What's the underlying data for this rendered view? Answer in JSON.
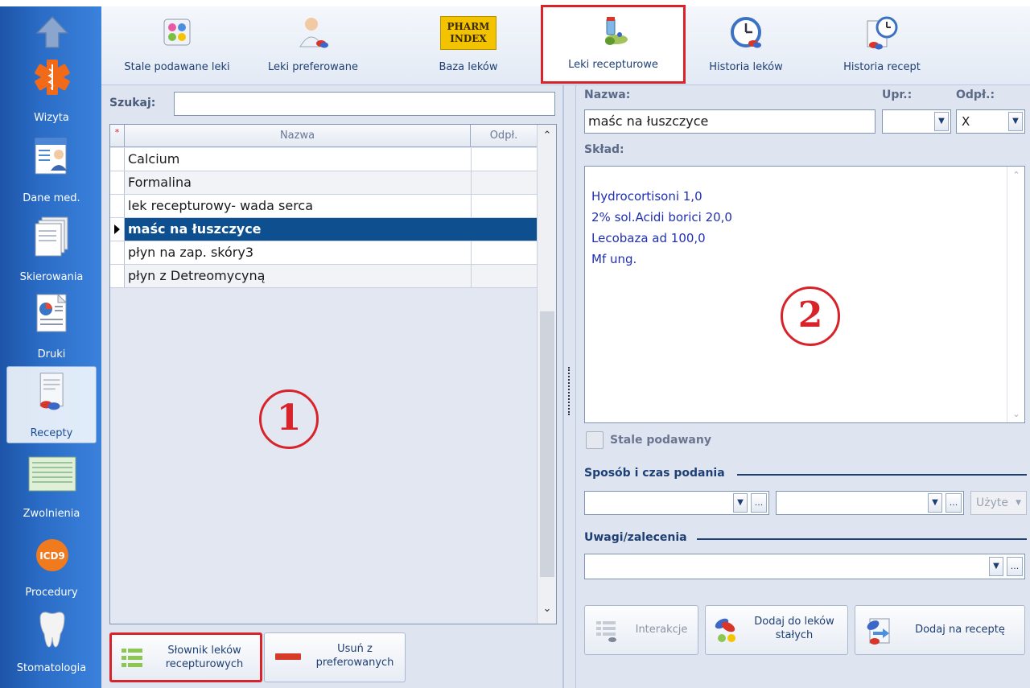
{
  "nav": {
    "items": [
      {
        "label": "",
        "icon": "up-arrow-icon"
      },
      {
        "label": "Wizyta",
        "icon": "medical-star-icon"
      },
      {
        "label": "Dane med.",
        "icon": "patient-card-icon"
      },
      {
        "label": "Skierowania",
        "icon": "documents-icon"
      },
      {
        "label": "Druki",
        "icon": "print-document-icon"
      },
      {
        "label": "Recepty",
        "icon": "prescription-icon"
      },
      {
        "label": "Zwolnienia",
        "icon": "sick-leave-icon"
      },
      {
        "label": "Procedury",
        "icon": "icd9-icon"
      },
      {
        "label": "Stomatologia",
        "icon": "tooth-icon"
      }
    ],
    "icd9_text": "ICD9"
  },
  "toolbar": {
    "buttons": [
      {
        "label": "Stale podawane leki"
      },
      {
        "label": "Leki preferowane"
      },
      {
        "label": "Baza leków"
      },
      {
        "label": "Leki recepturowe"
      },
      {
        "label": "Historia leków"
      },
      {
        "label": "Historia recept"
      }
    ],
    "pharm_logo": {
      "line1": "PHARM",
      "line2": "INDEX"
    }
  },
  "left": {
    "search_label": "Szukaj:",
    "search_value": "",
    "grid": {
      "header_star": "*",
      "columns": [
        "Nazwa",
        "Odpł."
      ],
      "rows": [
        {
          "name": "Calcium",
          "odpl": ""
        },
        {
          "name": "Formalina",
          "odpl": ""
        },
        {
          "name": "lek recepturowy- wada serca",
          "odpl": ""
        },
        {
          "name": "maśc na łuszczyce",
          "odpl": "",
          "selected": true
        },
        {
          "name": "płyn na zap. skóry3",
          "odpl": ""
        },
        {
          "name": "płyn z Detreomycyną",
          "odpl": ""
        }
      ]
    },
    "annotation": "1",
    "buttons": {
      "slownik": {
        "line1": "Słownik leków",
        "line2": "recepturowych"
      },
      "usun": {
        "line1": "Usuń z",
        "line2": "preferowanych"
      }
    }
  },
  "right": {
    "nazwa_label": "Nazwa:",
    "nazwa_value": "maśc na łuszczyce",
    "upr_label": "Upr.:",
    "upr_value": "",
    "odpl_label": "Odpł.:",
    "odpl_value": "X",
    "sklad_label": "Skład:",
    "sklad_lines": [
      "Hydrocortisoni 1,0",
      "2% sol.Acidi borici 20,0",
      "Lecobaza ad 100,0",
      "Mf ung."
    ],
    "annotation": "2",
    "stale_label": "Stale podawany",
    "sposob_label": "Sposób i czas podania",
    "uzyte_label": "Użyte",
    "uwagi_label": "Uwagi/zalecenia",
    "buttons": {
      "interakcje": "Interakcje",
      "dodaj_stale": {
        "line1": "Dodaj do leków",
        "line2": "stałych"
      },
      "dodaj_recepte": "Dodaj na receptę"
    }
  },
  "colors": {
    "accent": "#0d4f8f",
    "highlight": "#d8232a",
    "text_blue": "#1f2fb4"
  }
}
